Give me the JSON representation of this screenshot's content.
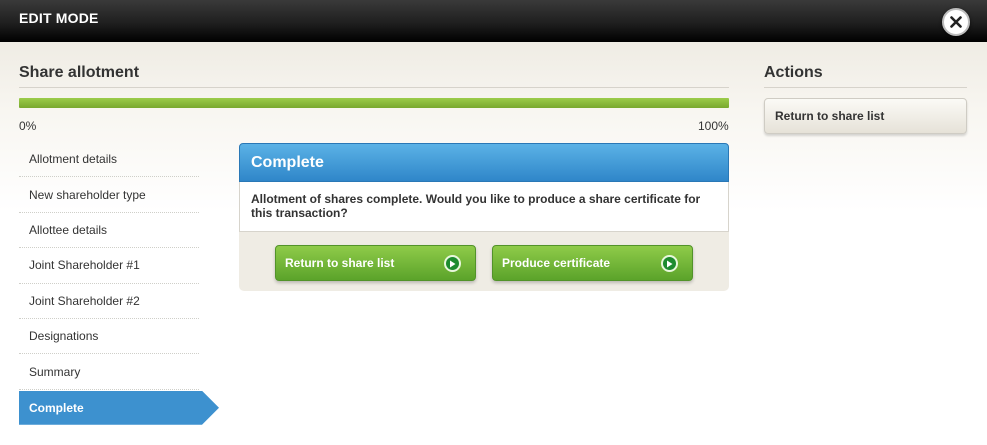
{
  "topbar": {
    "title": "EDIT MODE",
    "close_icon": "close-icon"
  },
  "main": {
    "title": "Share allotment",
    "progress": {
      "percent": 100,
      "min_label": "0%",
      "max_label": "100%",
      "fill_color": "#8cc540"
    },
    "steps": [
      {
        "label": "Allotment details",
        "active": false
      },
      {
        "label": "New shareholder type",
        "active": false
      },
      {
        "label": "Allottee details",
        "active": false
      },
      {
        "label": "Joint Shareholder #1",
        "active": false
      },
      {
        "label": "Joint Shareholder #2",
        "active": false
      },
      {
        "label": "Designations",
        "active": false
      },
      {
        "label": "Summary",
        "active": false
      },
      {
        "label": "Complete",
        "active": true
      }
    ],
    "panel": {
      "header": "Complete",
      "message": "Allotment of shares complete. Would you like to produce a share certificate for this transaction?",
      "buttons": {
        "return_label": "Return to share list",
        "produce_label": "Produce certificate",
        "arrow_icon": "arrow-right-circle-icon"
      }
    }
  },
  "actions": {
    "title": "Actions",
    "return_label": "Return to share list"
  },
  "colors": {
    "active_step": "#3d91cf",
    "panel_header": "#3a92d3",
    "primary_button": "#6db333"
  }
}
